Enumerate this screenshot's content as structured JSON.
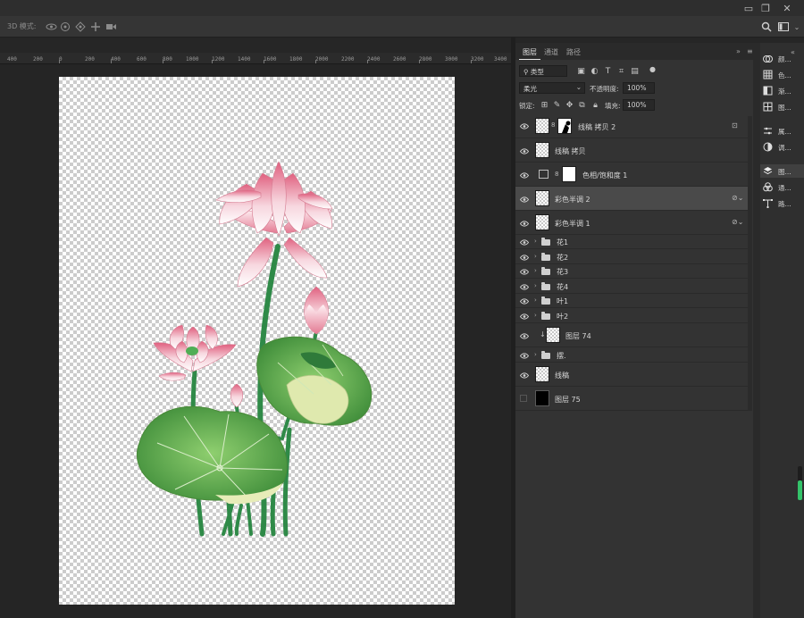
{
  "window": {
    "minimize": "▭",
    "restore": "❐",
    "close": "✕"
  },
  "options_bar": {
    "mode_label": "3D 模式:",
    "icons": [
      "rotate-3d-icon",
      "roll-3d-icon",
      "pan-3d-icon",
      "slide-3d-icon",
      "scale-3d-icon"
    ]
  },
  "ruler": {
    "ticks": [
      "400",
      "200",
      "0",
      "200",
      "400",
      "600",
      "800",
      "1000",
      "1200",
      "1400",
      "1600",
      "1800",
      "2000",
      "2200",
      "2400",
      "2600",
      "2800",
      "3000",
      "3200",
      "3400"
    ]
  },
  "panel": {
    "tabs": [
      "图层",
      "通道",
      "路径"
    ],
    "active_tab": "图层",
    "filter_kind": "类型",
    "blend_mode": "柔光",
    "opacity_label": "不透明度:",
    "opacity_value": "100%",
    "lock_label": "锁定:",
    "fill_label": "填充:",
    "fill_value": "100%",
    "layers": [
      {
        "name": "线稿 拷贝 2",
        "type": "pixel-mask",
        "visible": true,
        "locked": true
      },
      {
        "name": "线稿 拷贝",
        "type": "pixel",
        "visible": true
      },
      {
        "name": "色相/饱和度 1",
        "type": "adjustment",
        "visible": true
      },
      {
        "name": "彩色半调 2",
        "type": "smart",
        "visible": true,
        "selected": true
      },
      {
        "name": "彩色半调 1",
        "type": "smart",
        "visible": true
      },
      {
        "name": "花1",
        "type": "group",
        "visible": true
      },
      {
        "name": "花2",
        "type": "group",
        "visible": true
      },
      {
        "name": "花3",
        "type": "group",
        "visible": true
      },
      {
        "name": "花4",
        "type": "group",
        "visible": true
      },
      {
        "name": "叶1",
        "type": "group",
        "visible": true
      },
      {
        "name": "叶2",
        "type": "group",
        "visible": true
      },
      {
        "name": "图层 74",
        "type": "clipped-pixel",
        "visible": true
      },
      {
        "name": "摆.",
        "type": "group",
        "visible": true
      },
      {
        "name": "线稿",
        "type": "pixel",
        "visible": true
      },
      {
        "name": "图层 75",
        "type": "black-pixel",
        "visible": false
      }
    ]
  },
  "right_dock": [
    {
      "label": "颜...",
      "icon": "color-icon"
    },
    {
      "label": "色...",
      "icon": "swatches-icon"
    },
    {
      "label": "渐...",
      "icon": "gradient-icon"
    },
    {
      "label": "图...",
      "icon": "pattern-icon"
    },
    {
      "label": "属...",
      "icon": "properties-icon"
    },
    {
      "label": "调...",
      "icon": "adjustments-icon"
    },
    {
      "label": "图...",
      "icon": "layers-icon",
      "selected": true
    },
    {
      "label": "通...",
      "icon": "channels-icon"
    },
    {
      "label": "路...",
      "icon": "paths-icon"
    }
  ],
  "colors": {
    "petal_pink": "#e7889e",
    "leaf_green": "#5aa84a",
    "stem_green": "#2f8a48",
    "panel_bg": "#333333"
  }
}
